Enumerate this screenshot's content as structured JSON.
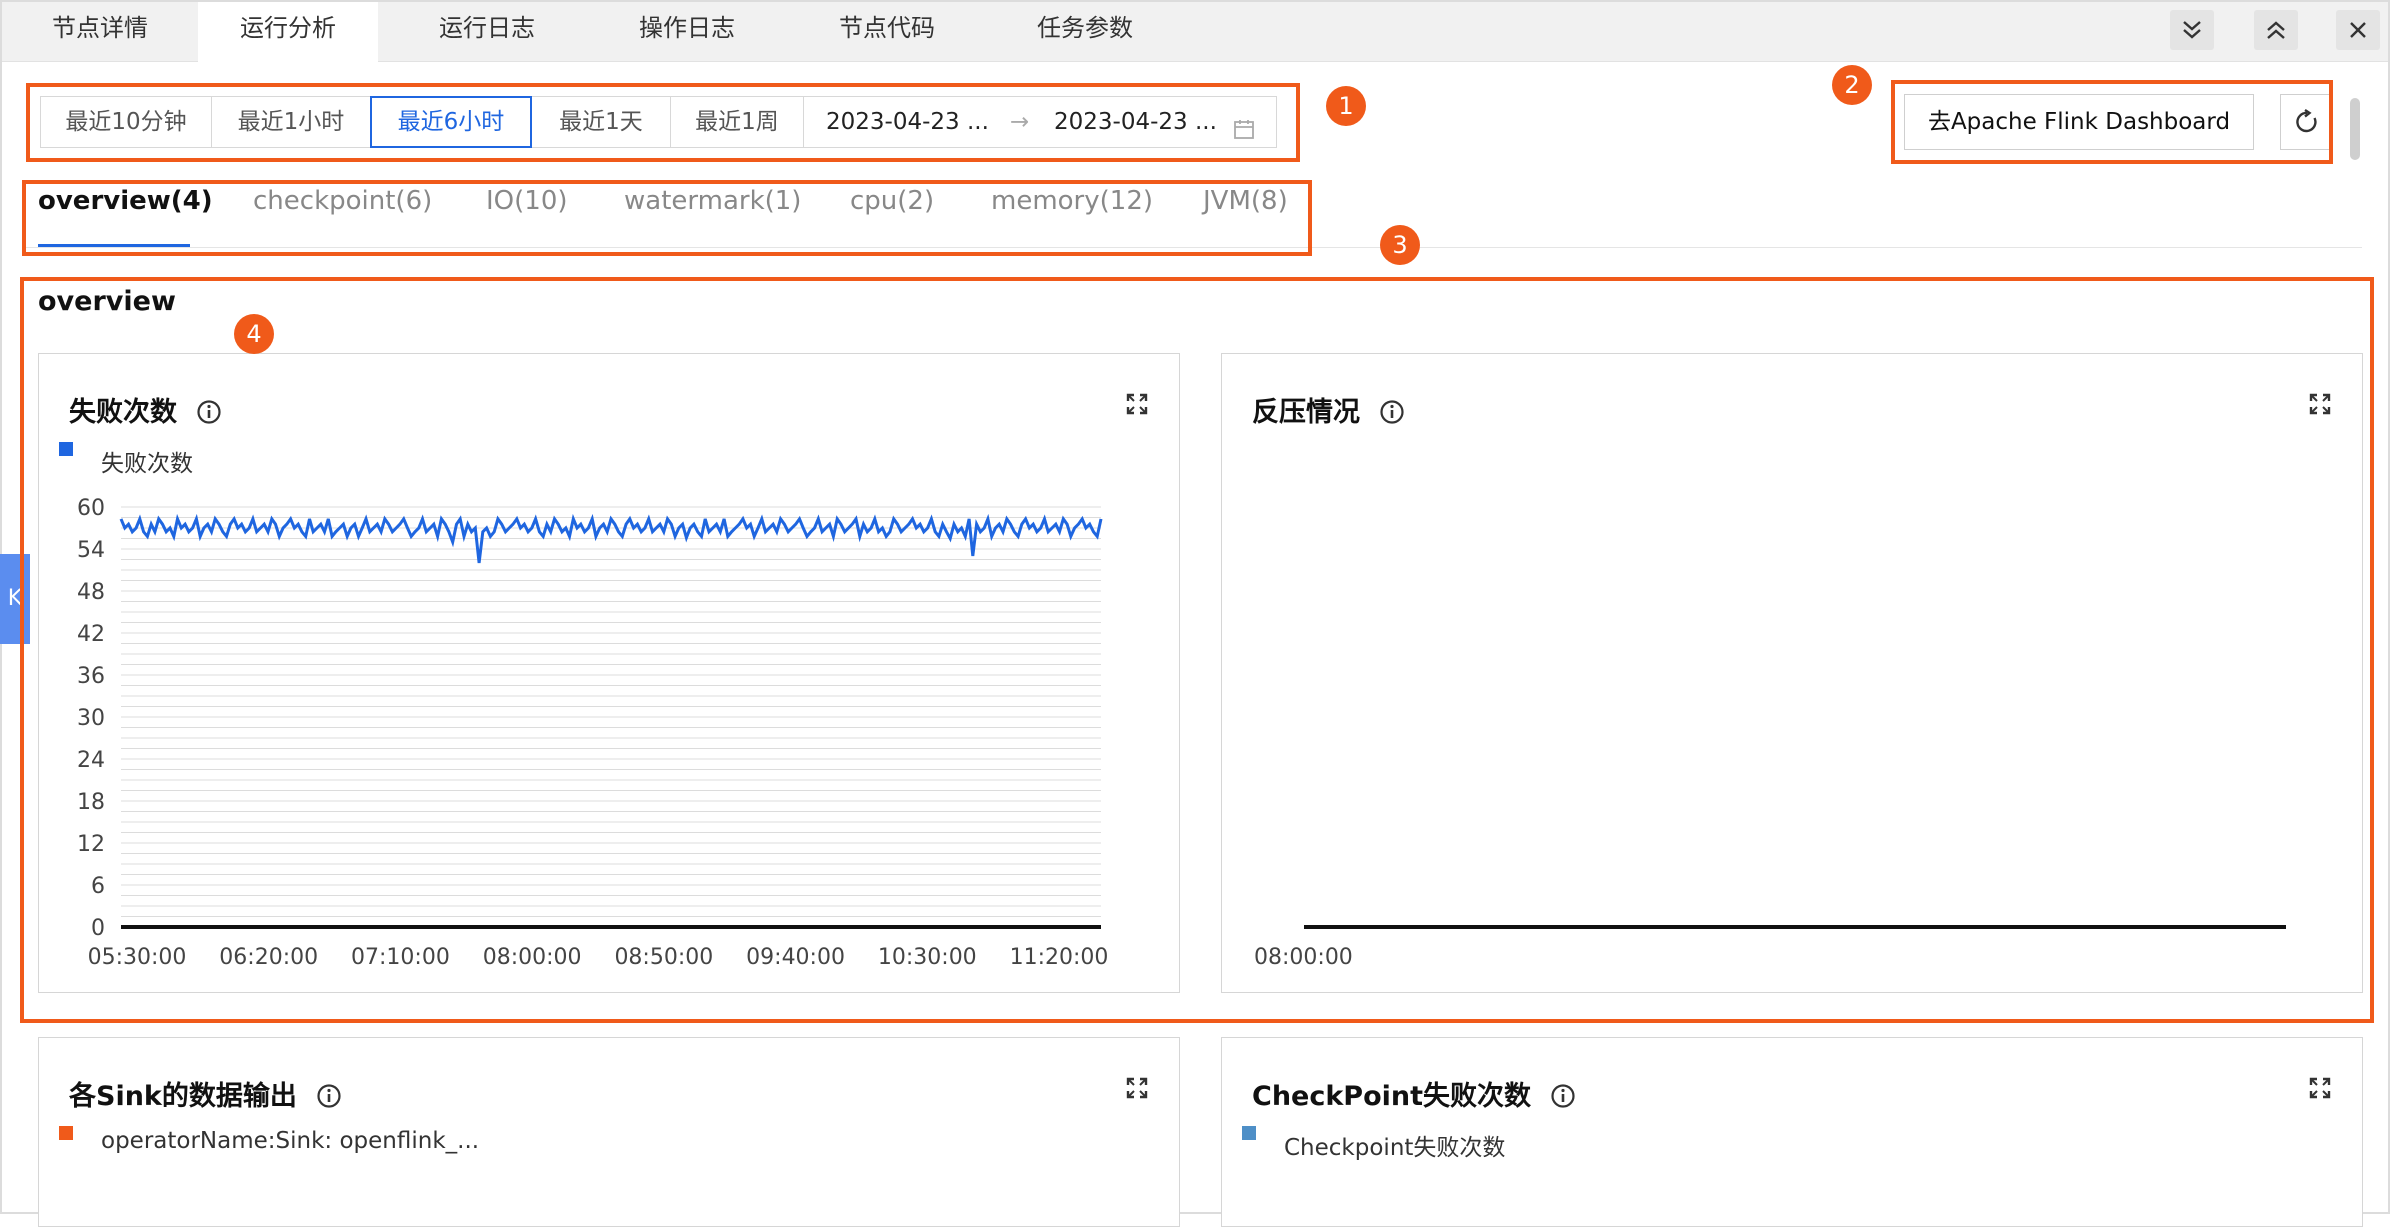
{
  "top_tabs": [
    {
      "label": "节点详情",
      "active": false
    },
    {
      "label": "运行分析",
      "active": true
    },
    {
      "label": "运行日志",
      "active": false
    },
    {
      "label": "操作日志",
      "active": false
    },
    {
      "label": "节点代码",
      "active": false
    },
    {
      "label": "任务参数",
      "active": false
    }
  ],
  "window_controls": {
    "collapse_all": "chevrons-down-icon",
    "expand_all": "chevrons-up-icon",
    "close": "close-icon"
  },
  "time_range": {
    "options": [
      "最近10分钟",
      "最近1小时",
      "最近6小时",
      "最近1天",
      "最近1周"
    ],
    "selected": "最近6小时",
    "start": "2023-04-23 ...",
    "arrow": "→",
    "end": "2023-04-23 ..."
  },
  "annotations": [
    "1",
    "2",
    "3",
    "4"
  ],
  "actions": {
    "flink_dashboard": "去Apache Flink Dashboard",
    "refresh_icon": "refresh-icon"
  },
  "metric_tabs": [
    {
      "label": "overview(4)",
      "active": true
    },
    {
      "label": "checkpoint(6)",
      "active": false
    },
    {
      "label": "IO(10)",
      "active": false
    },
    {
      "label": "watermark(1)",
      "active": false
    },
    {
      "label": "cpu(2)",
      "active": false
    },
    {
      "label": "memory(12)",
      "active": false
    },
    {
      "label": "JVM(8)",
      "active": false
    }
  ],
  "section_title": "overview",
  "side_handle": "K",
  "colors": {
    "accent": "#1f66e0",
    "annotation": "#f05a1a",
    "series_blue": "#1f66e0",
    "series_orange": "#f05a1a",
    "series_steel": "#4e8fc7"
  },
  "cards": {
    "failures": {
      "title": "失败次数",
      "legend": "失败次数"
    },
    "backpressure": {
      "title": "反压情况"
    },
    "sink": {
      "title": "各Sink的数据输出",
      "legend": "operatorName:Sink: openflink_..."
    },
    "checkpoint": {
      "title": "CheckPoint失败次数",
      "legend": "Checkpoint失败次数"
    }
  },
  "chart_data": [
    {
      "type": "line",
      "title": "失败次数",
      "series": [
        {
          "name": "失败次数",
          "baseline": 57,
          "dips": [
            {
              "x": "07:44:00",
              "y": 52
            },
            {
              "x": "10:35:00",
              "y": 53
            }
          ]
        }
      ],
      "x_ticks": [
        "05:30:00",
        "06:20:00",
        "07:10:00",
        "08:00:00",
        "08:50:00",
        "09:40:00",
        "10:30:00",
        "11:20:00"
      ],
      "y_ticks": [
        0,
        6,
        12,
        18,
        24,
        30,
        36,
        42,
        48,
        54,
        60
      ],
      "ylim": [
        0,
        60
      ],
      "grid": true
    },
    {
      "type": "line",
      "title": "反压情况",
      "series": [],
      "x_ticks": [
        "08:00:00"
      ],
      "y_ticks": [],
      "grid": false
    }
  ]
}
